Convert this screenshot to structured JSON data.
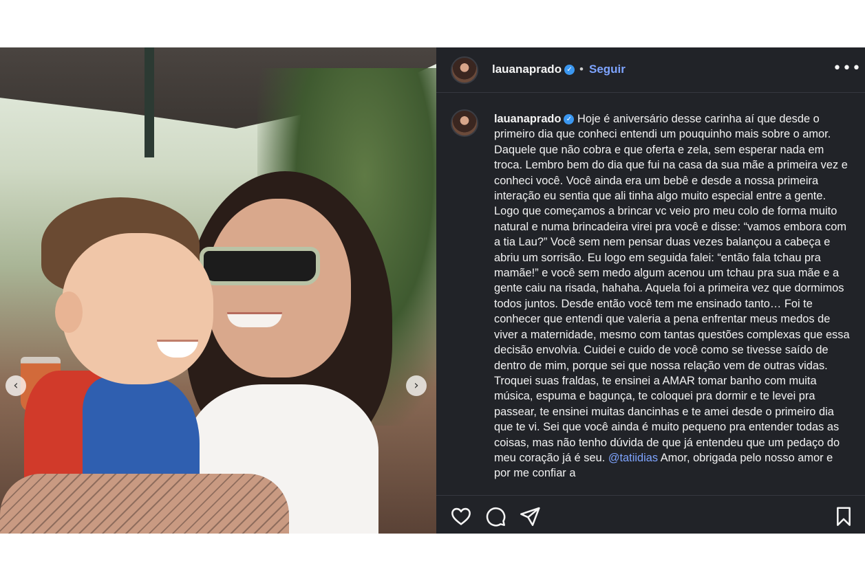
{
  "post": {
    "username": "lauanaprado",
    "verified_mark": "✓",
    "separator": "•",
    "follow_label": "Seguir",
    "more_label": "•••",
    "caption": {
      "username": "lauanaprado",
      "text_before_mention": "Hoje é aniversário desse carinha aí que desde o primeiro dia que conheci entendi um pouquinho mais sobre o amor. Daquele que não cobra e que oferta e zela, sem esperar nada em troca. Lembro bem do dia que fui na casa da sua mãe a primeira vez e conheci você. Você ainda era um bebê e desde a nossa primeira interação eu sentia que ali tinha algo muito especial entre a gente. Logo que começamos a brincar vc veio pro meu colo de forma muito natural e numa brincadeira virei pra você e disse: “vamos embora com a tia Lau?” Você sem nem pensar duas vezes balançou a cabeça e abriu um sorrisão. Eu logo em seguida falei: “então fala tchau pra mamãe!” e você sem medo algum acenou um tchau pra sua mãe e a gente caiu na risada, hahaha. Aquela foi a primeira vez que dormimos todos juntos. Desde então você tem me ensinado tanto… Foi te conhecer que entendi que valeria a pena enfrentar meus medos de viver a maternidade, mesmo com tantas questões complexas que essa decisão envolvia. Cuidei e cuido de você como se tivesse saído de dentro de mim, porque sei que nossa relação vem de outras vidas. Troquei suas fraldas, te ensinei a AMAR tomar banho com muita música, espuma e bagunça, te coloquei pra dormir e te levei pra passear, te ensinei muitas dancinhas e te amei desde o primeiro dia que te vi. Sei que você ainda é muito pequeno pra entender todas as coisas, mas não tenho dúvida de que já entendeu que um pedaço do meu coração já é seu.",
      "mention": "@tatiidias",
      "text_after_mention": "Amor, obrigada pelo nosso amor e por me confiar a"
    },
    "carousel": {
      "prev_icon": "‹",
      "next_icon": "›"
    }
  }
}
